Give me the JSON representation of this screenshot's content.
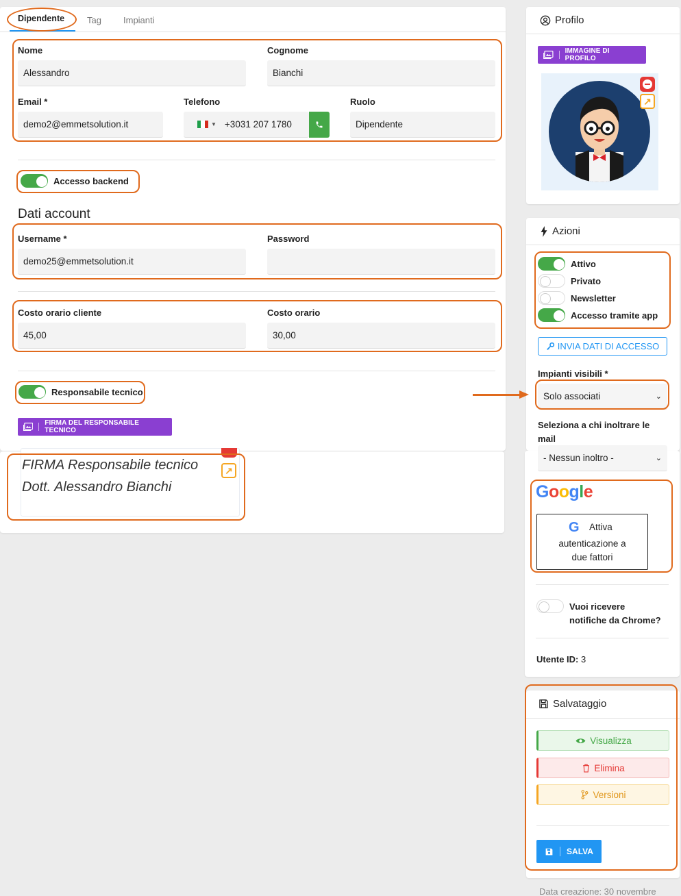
{
  "tabs": [
    {
      "label": "Dipendente",
      "active": true
    },
    {
      "label": "Tag"
    },
    {
      "label": "Impianti"
    }
  ],
  "form": {
    "nome": {
      "label": "Nome",
      "value": "Alessandro"
    },
    "cognome": {
      "label": "Cognome",
      "value": "Bianchi"
    },
    "email": {
      "label": "Email *",
      "value": "demo2@emmetsolution.it"
    },
    "telefono": {
      "label": "Telefono",
      "value": "+3031 207 1780"
    },
    "ruolo": {
      "label": "Ruolo",
      "value": "Dipendente"
    },
    "accesso_backend": {
      "label": "Accesso backend",
      "on": true
    },
    "dati_account_title": "Dati account",
    "username": {
      "label": "Username *",
      "value": "demo25@emmetsolution.it"
    },
    "password": {
      "label": "Password",
      "value": ""
    },
    "costo_cliente": {
      "label": "Costo orario cliente",
      "value": "45,00"
    },
    "costo_orario": {
      "label": "Costo orario",
      "value": "30,00"
    },
    "responsabile": {
      "label": "Responsabile tecnico",
      "on": true
    },
    "firma_button": "FIRMA DEL RESPONSABILE TECNICO",
    "firma_line1": "FIRMA Responsabile tecnico",
    "firma_line2": "Dott. Alessandro Bianchi"
  },
  "profilo": {
    "title": "Profilo",
    "image_button": "IMMAGINE DI PROFILO"
  },
  "azioni": {
    "title": "Azioni",
    "toggles": [
      {
        "label": "Attivo",
        "on": true
      },
      {
        "label": "Privato",
        "on": false
      },
      {
        "label": "Newsletter",
        "on": false
      },
      {
        "label": "Accesso tramite app",
        "on": true
      }
    ],
    "invia_button": "INVIA DATI DI ACCESSO",
    "impianti_label": "Impianti visibili *",
    "impianti_value": "Solo associati",
    "inoltro_label_1": "Seleziona a chi inoltrare le",
    "inoltro_label_2": "mail",
    "inoltro_value": "- Nessun inoltro -",
    "google_logo": "Google",
    "twofa_line1": "Attiva",
    "twofa_line2": "autenticazione a",
    "twofa_line3": "due fattori",
    "chrome_line1": "Vuoi ricevere",
    "chrome_line2": "notifiche da Chrome?",
    "utente_label": "Utente ID:",
    "utente_value": "3"
  },
  "salvataggio": {
    "title": "Salvataggio",
    "visualizza": "Visualizza",
    "elimina": "Elimina",
    "versioni": "Versioni",
    "salva": "SALVA",
    "data_creazione": "Data creazione: 30 novembre"
  },
  "colors": {
    "accent_orange": "#e06a1d",
    "purple": "#8a3fd1",
    "green": "#45a848",
    "blue": "#2196f3",
    "red": "#e53935",
    "yellow": "#f5a623"
  }
}
